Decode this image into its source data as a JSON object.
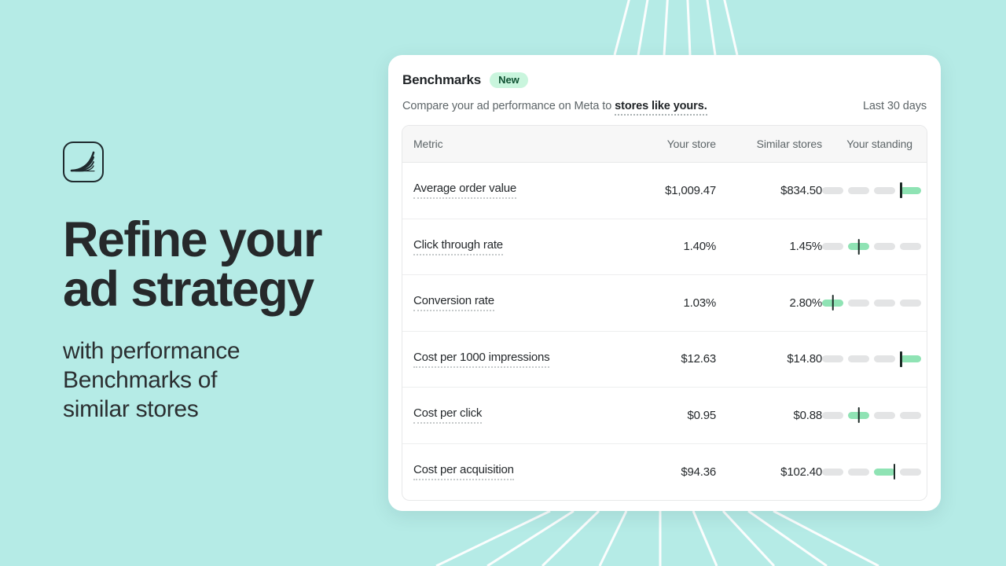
{
  "theme": {
    "background": "#b5ebe6",
    "ray_color": "#ffffff",
    "card_background": "#ffffff",
    "accent_green": "#8fe3b4",
    "badge_background": "#c9f5dd",
    "badge_text": "#0f5132",
    "marker_color": "#1d2b27",
    "segment_inactive": "#e3e4e5",
    "text_primary": "#24282b",
    "text_secondary": "#5d6568"
  },
  "left_panel": {
    "logo_name": "shopify-style-fan-logo",
    "headline_lines": [
      "Refine your",
      "ad strategy"
    ],
    "subhead_lines": [
      "with performance",
      "Benchmarks of",
      "similar stores"
    ]
  },
  "card": {
    "title": "Benchmarks",
    "badge": "New",
    "subtitle_prefix": "Compare your ad performance on Meta to ",
    "subtitle_link": "stores like yours.",
    "date_range": "Last 30 days",
    "columns": [
      "Metric",
      "Your store",
      "Similar stores",
      "Your standing"
    ],
    "rows": [
      {
        "metric": "Average order value",
        "your_store": "$1,009.47",
        "similar_stores": "$834.50",
        "standing_segments": 4,
        "standing_active_index": 3,
        "marker_position": "left"
      },
      {
        "metric": "Click through rate",
        "your_store": "1.40%",
        "similar_stores": "1.45%",
        "standing_segments": 4,
        "standing_active_index": 1,
        "marker_position": "center"
      },
      {
        "metric": "Conversion rate",
        "your_store": "1.03%",
        "similar_stores": "2.80%",
        "standing_segments": 4,
        "standing_active_index": 0,
        "marker_position": "center"
      },
      {
        "metric": "Cost per 1000 impressions",
        "your_store": "$12.63",
        "similar_stores": "$14.80",
        "standing_segments": 4,
        "standing_active_index": 3,
        "marker_position": "left"
      },
      {
        "metric": "Cost per click",
        "your_store": "$0.95",
        "similar_stores": "$0.88",
        "standing_segments": 4,
        "standing_active_index": 1,
        "marker_position": "center"
      },
      {
        "metric": "Cost per acquisition",
        "your_store": "$94.36",
        "similar_stores": "$102.40",
        "standing_segments": 4,
        "standing_active_index": 2,
        "marker_position": "right"
      }
    ]
  }
}
